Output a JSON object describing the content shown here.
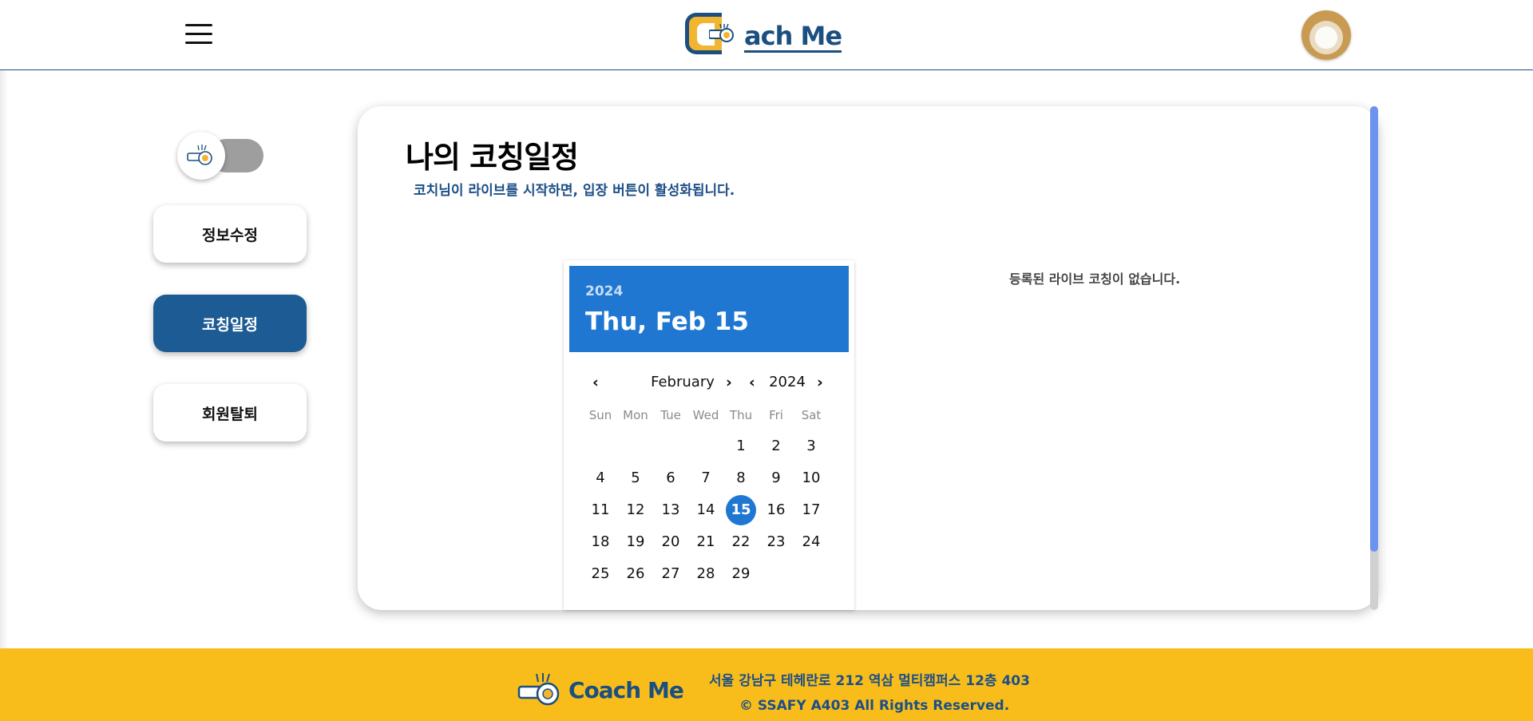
{
  "header": {
    "logo_text": "ach Me",
    "logo_letter": "C"
  },
  "sidebar": {
    "items": [
      {
        "label": "정보수정",
        "active": false
      },
      {
        "label": "코칭일정",
        "active": true
      },
      {
        "label": "회원탈퇴",
        "active": false
      }
    ]
  },
  "main": {
    "title": "나의 코칭일정",
    "subtitle": "코치님이 라이브를 시작하면, 입장 버튼이 활성화됩니다.",
    "empty_message": "등록된 라이브 코칭이 없습니다."
  },
  "calendar": {
    "selected_year": "2024",
    "selected_date": "Thu, Feb 15",
    "nav_prev": "‹",
    "nav_next": "›",
    "month_label": "February",
    "year_label": "2024",
    "weekdays": [
      "Sun",
      "Mon",
      "Tue",
      "Wed",
      "Thu",
      "Fri",
      "Sat"
    ],
    "first_weekday_index": 4,
    "days_in_month": 29,
    "selected_day": 15
  },
  "footer": {
    "logo_text": "Coach Me",
    "address": "서울 강남구 테헤란로 212 역삼 멀티캠퍼스 12층 403",
    "copyright": "© SSAFY A403 All Rights Reserved."
  },
  "colors": {
    "primary": "#1d5b94",
    "calendar_accent": "#1f77d2",
    "footer_bg": "#f8bd1a",
    "scroll_thumb": "#6b93f0"
  }
}
